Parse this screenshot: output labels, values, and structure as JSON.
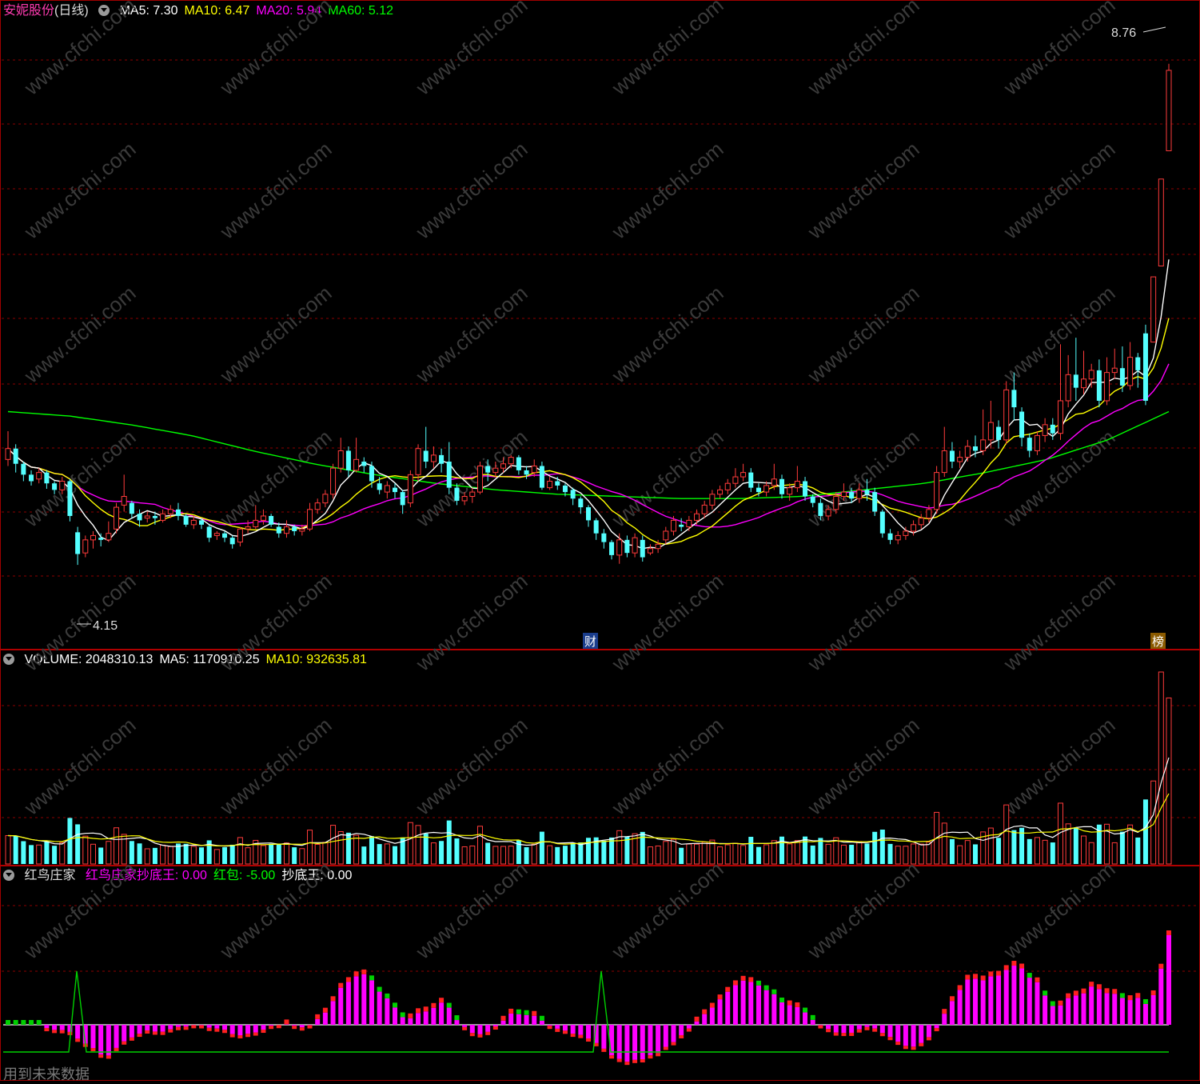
{
  "price_panel": {
    "stock_name": "安妮股份",
    "period": "(日线)",
    "ma_items": [
      {
        "label": "MA5: 7.30",
        "color": "#ffffff"
      },
      {
        "label": "MA10: 6.47",
        "color": "#ffff00"
      },
      {
        "label": "MA20: 5.94",
        "color": "#ff00ff"
      },
      {
        "label": "MA60: 5.12",
        "color": "#00ff00"
      }
    ],
    "high_label": "8.76",
    "low_label": "4.15",
    "marker_cai": "财",
    "marker_bang": "榜"
  },
  "volume_panel": {
    "items": [
      {
        "label": "VOLUME: 2048310.13",
        "color": "#ffffff"
      },
      {
        "label": "MA5: 1170910.25",
        "color": "#ffffff"
      },
      {
        "label": "MA10: 932635.81",
        "color": "#ffff00"
      }
    ]
  },
  "indicator_panel": {
    "name": "红鸟庄家",
    "items": [
      {
        "label": "红鸟庄家抄底王: 0.00",
        "color": "#ff00ff"
      },
      {
        "label": "红包: -5.00",
        "color": "#00ff00"
      },
      {
        "label": "抄底王: 0.00",
        "color": "#ffffff"
      }
    ]
  },
  "footer_note": "用到未来数据",
  "watermark": "www.cfchi.com",
  "colors": {
    "up": "#ff3b3b",
    "down": "#54ffff",
    "grid": "#8b0000",
    "ma5": "#ffffff",
    "ma10": "#ffff00",
    "ma20": "#ff00ff",
    "ma60": "#00ff00"
  },
  "chart_data": {
    "type": "candlestick",
    "price_scale": [
      3.4,
      9.2
    ],
    "candles": [
      {
        "o": 5.12,
        "c": 5.22,
        "h": 5.38,
        "l": 5.06
      },
      {
        "o": 5.22,
        "c": 5.08,
        "h": 5.26,
        "l": 5.0
      },
      {
        "o": 5.08,
        "c": 4.98,
        "h": 5.1,
        "l": 4.92
      },
      {
        "o": 4.98,
        "c": 4.92,
        "h": 5.02,
        "l": 4.88
      },
      {
        "o": 4.94,
        "c": 5.0,
        "h": 5.04,
        "l": 4.9
      },
      {
        "o": 5.0,
        "c": 4.9,
        "h": 5.02,
        "l": 4.85
      },
      {
        "o": 4.9,
        "c": 4.84,
        "h": 4.92,
        "l": 4.8
      },
      {
        "o": 4.84,
        "c": 4.92,
        "h": 4.96,
        "l": 4.8
      },
      {
        "o": 4.92,
        "c": 4.6,
        "h": 4.94,
        "l": 4.55
      },
      {
        "o": 4.45,
        "c": 4.25,
        "h": 4.5,
        "l": 4.15
      },
      {
        "o": 4.26,
        "c": 4.38,
        "h": 4.42,
        "l": 4.22
      },
      {
        "o": 4.38,
        "c": 4.42,
        "h": 4.46,
        "l": 4.3
      },
      {
        "o": 4.4,
        "c": 4.38,
        "h": 4.44,
        "l": 4.32
      },
      {
        "o": 4.38,
        "c": 4.44,
        "h": 4.55,
        "l": 4.36
      },
      {
        "o": 4.48,
        "c": 4.68,
        "h": 4.72,
        "l": 4.44
      },
      {
        "o": 4.7,
        "c": 4.78,
        "h": 4.98,
        "l": 4.64
      },
      {
        "o": 4.72,
        "c": 4.62,
        "h": 4.74,
        "l": 4.58
      },
      {
        "o": 4.62,
        "c": 4.56,
        "h": 4.66,
        "l": 4.5
      },
      {
        "o": 4.58,
        "c": 4.6,
        "h": 4.64,
        "l": 4.54
      },
      {
        "o": 4.6,
        "c": 4.58,
        "h": 4.64,
        "l": 4.52
      },
      {
        "o": 4.56,
        "c": 4.62,
        "h": 4.66,
        "l": 4.54
      },
      {
        "o": 4.62,
        "c": 4.66,
        "h": 4.7,
        "l": 4.58
      },
      {
        "o": 4.66,
        "c": 4.6,
        "h": 4.72,
        "l": 4.56
      },
      {
        "o": 4.6,
        "c": 4.52,
        "h": 4.62,
        "l": 4.5
      },
      {
        "o": 4.52,
        "c": 4.56,
        "h": 4.6,
        "l": 4.48
      },
      {
        "o": 4.56,
        "c": 4.52,
        "h": 4.58,
        "l": 4.48
      },
      {
        "o": 4.5,
        "c": 4.4,
        "h": 4.52,
        "l": 4.36
      },
      {
        "o": 4.42,
        "c": 4.44,
        "h": 4.46,
        "l": 4.38
      },
      {
        "o": 4.44,
        "c": 4.4,
        "h": 4.46,
        "l": 4.36
      },
      {
        "o": 4.4,
        "c": 4.34,
        "h": 4.42,
        "l": 4.3
      },
      {
        "o": 4.36,
        "c": 4.48,
        "h": 4.5,
        "l": 4.32
      },
      {
        "o": 4.48,
        "c": 4.5,
        "h": 4.56,
        "l": 4.44
      },
      {
        "o": 4.5,
        "c": 4.56,
        "h": 4.7,
        "l": 4.48
      },
      {
        "o": 4.56,
        "c": 4.6,
        "h": 4.66,
        "l": 4.52
      },
      {
        "o": 4.6,
        "c": 4.52,
        "h": 4.62,
        "l": 4.5
      },
      {
        "o": 4.5,
        "c": 4.44,
        "h": 4.54,
        "l": 4.4
      },
      {
        "o": 4.44,
        "c": 4.5,
        "h": 4.56,
        "l": 4.4
      },
      {
        "o": 4.5,
        "c": 4.46,
        "h": 4.52,
        "l": 4.42
      },
      {
        "o": 4.46,
        "c": 4.48,
        "h": 4.52,
        "l": 4.42
      },
      {
        "o": 4.48,
        "c": 4.66,
        "h": 4.72,
        "l": 4.46
      },
      {
        "o": 4.66,
        "c": 4.72,
        "h": 4.76,
        "l": 4.62
      },
      {
        "o": 4.72,
        "c": 4.8,
        "h": 4.84,
        "l": 4.68
      },
      {
        "o": 4.8,
        "c": 5.04,
        "h": 5.08,
        "l": 4.76
      },
      {
        "o": 5.04,
        "c": 5.2,
        "h": 5.32,
        "l": 5.0
      },
      {
        "o": 5.2,
        "c": 5.02,
        "h": 5.24,
        "l": 4.96
      },
      {
        "o": 5.02,
        "c": 5.12,
        "h": 5.32,
        "l": 5.0
      },
      {
        "o": 5.1,
        "c": 5.06,
        "h": 5.14,
        "l": 5.0
      },
      {
        "o": 5.06,
        "c": 4.92,
        "h": 5.1,
        "l": 4.86
      },
      {
        "o": 4.9,
        "c": 4.84,
        "h": 4.96,
        "l": 4.8
      },
      {
        "o": 4.82,
        "c": 4.88,
        "h": 4.92,
        "l": 4.76
      },
      {
        "o": 4.86,
        "c": 4.82,
        "h": 4.9,
        "l": 4.76
      },
      {
        "o": 4.82,
        "c": 4.7,
        "h": 4.84,
        "l": 4.62
      },
      {
        "o": 4.72,
        "c": 4.98,
        "h": 5.02,
        "l": 4.68
      },
      {
        "o": 4.98,
        "c": 5.22,
        "h": 5.26,
        "l": 4.92
      },
      {
        "o": 5.2,
        "c": 5.1,
        "h": 5.42,
        "l": 5.04
      },
      {
        "o": 5.1,
        "c": 5.16,
        "h": 5.24,
        "l": 5.04
      },
      {
        "o": 5.16,
        "c": 5.08,
        "h": 5.22,
        "l": 5.0
      },
      {
        "o": 5.1,
        "c": 4.86,
        "h": 5.28,
        "l": 4.8
      },
      {
        "o": 4.86,
        "c": 4.74,
        "h": 4.9,
        "l": 4.7
      },
      {
        "o": 4.74,
        "c": 4.78,
        "h": 4.82,
        "l": 4.7
      },
      {
        "o": 4.78,
        "c": 4.82,
        "h": 4.86,
        "l": 4.72
      },
      {
        "o": 4.82,
        "c": 5.06,
        "h": 5.1,
        "l": 4.8
      },
      {
        "o": 5.06,
        "c": 5.0,
        "h": 5.12,
        "l": 4.92
      },
      {
        "o": 5.0,
        "c": 5.04,
        "h": 5.1,
        "l": 4.96
      },
      {
        "o": 5.04,
        "c": 5.08,
        "h": 5.14,
        "l": 5.0
      },
      {
        "o": 5.08,
        "c": 5.14,
        "h": 5.16,
        "l": 5.04
      },
      {
        "o": 5.14,
        "c": 5.02,
        "h": 5.16,
        "l": 4.98
      },
      {
        "o": 5.02,
        "c": 4.98,
        "h": 5.06,
        "l": 4.94
      },
      {
        "o": 5.0,
        "c": 5.06,
        "h": 5.12,
        "l": 4.96
      },
      {
        "o": 5.06,
        "c": 4.86,
        "h": 5.1,
        "l": 4.84
      },
      {
        "o": 4.86,
        "c": 4.92,
        "h": 4.96,
        "l": 4.84
      },
      {
        "o": 4.92,
        "c": 4.88,
        "h": 4.96,
        "l": 4.84
      },
      {
        "o": 4.88,
        "c": 4.82,
        "h": 4.9,
        "l": 4.78
      },
      {
        "o": 4.84,
        "c": 4.76,
        "h": 4.86,
        "l": 4.7
      },
      {
        "o": 4.76,
        "c": 4.68,
        "h": 4.78,
        "l": 4.62
      },
      {
        "o": 4.68,
        "c": 4.56,
        "h": 4.7,
        "l": 4.5
      },
      {
        "o": 4.56,
        "c": 4.44,
        "h": 4.58,
        "l": 4.38
      },
      {
        "o": 4.44,
        "c": 4.36,
        "h": 4.48,
        "l": 4.3
      },
      {
        "o": 4.36,
        "c": 4.24,
        "h": 4.38,
        "l": 4.2
      },
      {
        "o": 4.24,
        "c": 4.38,
        "h": 4.44,
        "l": 4.16
      },
      {
        "o": 4.38,
        "c": 4.26,
        "h": 4.42,
        "l": 4.22
      },
      {
        "o": 4.26,
        "c": 4.4,
        "h": 4.44,
        "l": 4.22
      },
      {
        "o": 4.38,
        "c": 4.22,
        "h": 4.42,
        "l": 4.18
      },
      {
        "o": 4.26,
        "c": 4.3,
        "h": 4.34,
        "l": 4.24
      },
      {
        "o": 4.3,
        "c": 4.34,
        "h": 4.38,
        "l": 4.26
      },
      {
        "o": 4.38,
        "c": 4.46,
        "h": 4.5,
        "l": 4.34
      },
      {
        "o": 4.46,
        "c": 4.56,
        "h": 4.6,
        "l": 4.42
      },
      {
        "o": 4.52,
        "c": 4.5,
        "h": 4.58,
        "l": 4.46
      },
      {
        "o": 4.5,
        "c": 4.56,
        "h": 4.6,
        "l": 4.46
      },
      {
        "o": 4.56,
        "c": 4.62,
        "h": 4.66,
        "l": 4.52
      },
      {
        "o": 4.62,
        "c": 4.7,
        "h": 4.74,
        "l": 4.58
      },
      {
        "o": 4.7,
        "c": 4.8,
        "h": 4.84,
        "l": 4.66
      },
      {
        "o": 4.8,
        "c": 4.84,
        "h": 4.88,
        "l": 4.76
      },
      {
        "o": 4.84,
        "c": 4.9,
        "h": 4.94,
        "l": 4.8
      },
      {
        "o": 4.9,
        "c": 4.96,
        "h": 5.04,
        "l": 4.86
      },
      {
        "o": 4.96,
        "c": 5.0,
        "h": 5.08,
        "l": 4.92
      },
      {
        "o": 5.0,
        "c": 4.86,
        "h": 5.04,
        "l": 4.82
      },
      {
        "o": 4.86,
        "c": 4.82,
        "h": 4.9,
        "l": 4.78
      },
      {
        "o": 4.82,
        "c": 4.88,
        "h": 4.92,
        "l": 4.78
      },
      {
        "o": 4.88,
        "c": 4.94,
        "h": 5.08,
        "l": 4.84
      },
      {
        "o": 4.94,
        "c": 4.8,
        "h": 4.98,
        "l": 4.76
      },
      {
        "o": 4.8,
        "c": 4.86,
        "h": 4.9,
        "l": 4.74
      },
      {
        "o": 4.86,
        "c": 4.92,
        "h": 5.06,
        "l": 4.82
      },
      {
        "o": 4.92,
        "c": 4.78,
        "h": 4.96,
        "l": 4.74
      },
      {
        "o": 4.78,
        "c": 4.72,
        "h": 4.8,
        "l": 4.68
      },
      {
        "o": 4.72,
        "c": 4.6,
        "h": 4.76,
        "l": 4.56
      },
      {
        "o": 4.6,
        "c": 4.66,
        "h": 4.7,
        "l": 4.56
      },
      {
        "o": 4.66,
        "c": 4.78,
        "h": 4.82,
        "l": 4.62
      },
      {
        "o": 4.78,
        "c": 4.82,
        "h": 4.9,
        "l": 4.74
      },
      {
        "o": 4.82,
        "c": 4.76,
        "h": 4.86,
        "l": 4.72
      },
      {
        "o": 4.76,
        "c": 4.84,
        "h": 4.9,
        "l": 4.72
      },
      {
        "o": 4.84,
        "c": 4.8,
        "h": 4.94,
        "l": 4.74
      },
      {
        "o": 4.82,
        "c": 4.64,
        "h": 4.86,
        "l": 4.6
      },
      {
        "o": 4.64,
        "c": 4.44,
        "h": 4.66,
        "l": 4.4
      },
      {
        "o": 4.44,
        "c": 4.38,
        "h": 4.48,
        "l": 4.34
      },
      {
        "o": 4.38,
        "c": 4.42,
        "h": 4.46,
        "l": 4.34
      },
      {
        "o": 4.42,
        "c": 4.46,
        "h": 4.5,
        "l": 4.38
      },
      {
        "o": 4.46,
        "c": 4.52,
        "h": 4.56,
        "l": 4.42
      },
      {
        "o": 4.52,
        "c": 4.58,
        "h": 4.62,
        "l": 4.48
      },
      {
        "o": 4.58,
        "c": 4.66,
        "h": 4.7,
        "l": 4.54
      },
      {
        "o": 4.66,
        "c": 5.0,
        "h": 5.06,
        "l": 4.62
      },
      {
        "o": 5.0,
        "c": 5.2,
        "h": 5.42,
        "l": 4.96
      },
      {
        "o": 5.2,
        "c": 5.1,
        "h": 5.28,
        "l": 5.04
      },
      {
        "o": 5.1,
        "c": 5.14,
        "h": 5.2,
        "l": 5.04
      },
      {
        "o": 5.14,
        "c": 5.24,
        "h": 5.3,
        "l": 5.1
      },
      {
        "o": 5.24,
        "c": 5.2,
        "h": 5.34,
        "l": 5.14
      },
      {
        "o": 5.2,
        "c": 5.3,
        "h": 5.58,
        "l": 5.16
      },
      {
        "o": 5.3,
        "c": 5.46,
        "h": 5.66,
        "l": 5.22
      },
      {
        "o": 5.42,
        "c": 5.3,
        "h": 5.48,
        "l": 5.22
      },
      {
        "o": 5.3,
        "c": 5.76,
        "h": 5.84,
        "l": 5.26
      },
      {
        "o": 5.76,
        "c": 5.6,
        "h": 5.92,
        "l": 5.48
      },
      {
        "o": 5.56,
        "c": 5.32,
        "h": 5.6,
        "l": 5.24
      },
      {
        "o": 5.32,
        "c": 5.2,
        "h": 5.36,
        "l": 5.14
      },
      {
        "o": 5.2,
        "c": 5.34,
        "h": 5.38,
        "l": 5.16
      },
      {
        "o": 5.34,
        "c": 5.44,
        "h": 5.5,
        "l": 5.28
      },
      {
        "o": 5.44,
        "c": 5.36,
        "h": 5.5,
        "l": 5.3
      },
      {
        "o": 5.36,
        "c": 5.66,
        "h": 6.18,
        "l": 5.3
      },
      {
        "o": 5.66,
        "c": 5.9,
        "h": 6.08,
        "l": 5.6
      },
      {
        "o": 5.9,
        "c": 5.78,
        "h": 6.24,
        "l": 5.66
      },
      {
        "o": 5.78,
        "c": 5.86,
        "h": 6.12,
        "l": 5.72
      },
      {
        "o": 5.86,
        "c": 5.94,
        "h": 6.0,
        "l": 5.78
      },
      {
        "o": 5.94,
        "c": 5.66,
        "h": 6.04,
        "l": 5.6
      },
      {
        "o": 5.66,
        "c": 5.92,
        "h": 6.06,
        "l": 5.62
      },
      {
        "o": 5.92,
        "c": 5.96,
        "h": 6.14,
        "l": 5.86
      },
      {
        "o": 5.96,
        "c": 5.8,
        "h": 6.16,
        "l": 5.74
      },
      {
        "o": 5.8,
        "c": 6.06,
        "h": 6.2,
        "l": 5.76
      },
      {
        "o": 6.06,
        "c": 5.94,
        "h": 6.1,
        "l": 5.78
      },
      {
        "o": 6.28,
        "c": 5.66,
        "h": 6.36,
        "l": 5.62
      },
      {
        "o": 6.2,
        "c": 6.8,
        "h": 6.8,
        "l": 6.2
      },
      {
        "o": 6.9,
        "c": 7.7,
        "h": 7.7,
        "l": 6.9
      },
      {
        "o": 7.96,
        "c": 8.7,
        "h": 8.76,
        "l": 7.96
      }
    ],
    "ma60_curve": [
      5.56,
      5.52,
      5.44,
      5.34,
      5.2,
      5.08,
      4.98,
      4.9,
      4.84,
      4.8,
      4.78,
      4.76,
      4.76,
      4.78,
      4.84,
      4.9,
      5.0,
      5.12,
      5.3,
      5.56
    ]
  }
}
